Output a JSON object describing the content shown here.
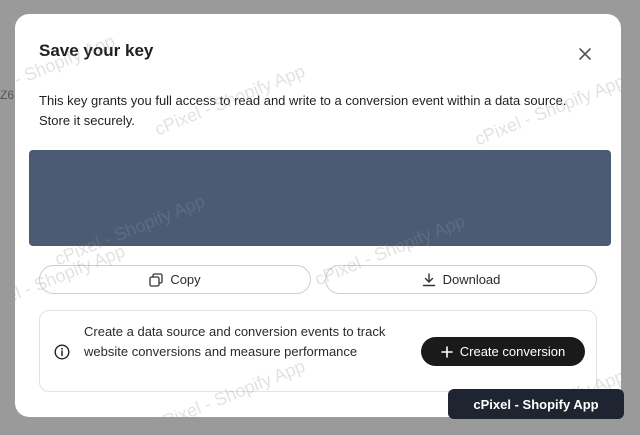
{
  "backdrop": {
    "fragment": "Z6"
  },
  "modal": {
    "title": "Save your key",
    "description": "This key grants you full access to read and write to a conversion event within a data source. Store it securely.",
    "buttons": {
      "copy_label": "Copy",
      "download_label": "Download"
    },
    "info": {
      "text": "Create a data source and conversion events to track website conversions and measure performance",
      "create_label": "Create conversion"
    }
  },
  "watermark": "cPixel - Shopify App",
  "badge": {
    "label": "cPixel - Shopify App"
  },
  "colors": {
    "key_box": "#4a5b73",
    "primary_button": "#1a1a1a",
    "badge": "#1e2430"
  }
}
